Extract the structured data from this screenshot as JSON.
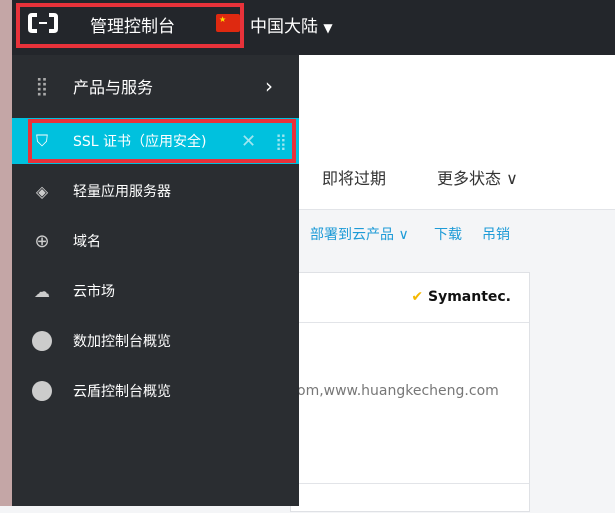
{
  "topbar": {
    "title": "管理控制台",
    "region": "中国大陆"
  },
  "sidebar": {
    "products": "产品与服务",
    "items": [
      {
        "label": "SSL 证书（应用安全)",
        "icon": "shield-icon"
      },
      {
        "label": "轻量应用服务器",
        "icon": "layers-icon"
      },
      {
        "label": "域名",
        "icon": "globe-icon"
      },
      {
        "label": "云市场",
        "icon": "market-icon"
      },
      {
        "label": "数加控制台概览",
        "icon": "circle-icon"
      },
      {
        "label": "云盾控制台概览",
        "icon": "circle-icon"
      }
    ]
  },
  "tabs": {
    "expiring": "即将过期",
    "more": "更多状态"
  },
  "card": {
    "brand": "Symantec.",
    "domain": "om,www.huangkecheng.com",
    "deploy": "部署到云产品",
    "download": "下载",
    "revoke": "吊销"
  },
  "colors": {
    "active": "#00c1de",
    "highlight": "#e8323a"
  }
}
